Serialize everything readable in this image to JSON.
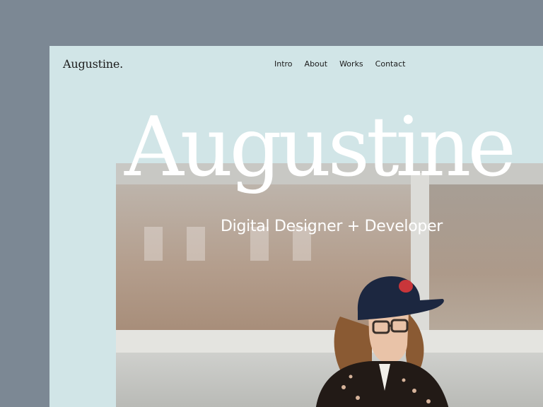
{
  "header": {
    "logo": "Augustine.",
    "nav": [
      {
        "label": "Intro"
      },
      {
        "label": "About"
      },
      {
        "label": "Works"
      },
      {
        "label": "Contact"
      }
    ]
  },
  "hero": {
    "title": "Augustine",
    "subtitle": "Digital Designer + Developer",
    "photo_subject": "person-wearing-cap-and-glasses"
  },
  "colors": {
    "page_background": "#7c8894",
    "site_background": "#d1e5e7",
    "text_dark": "#1b1b1b",
    "hero_text": "#ffffff"
  }
}
